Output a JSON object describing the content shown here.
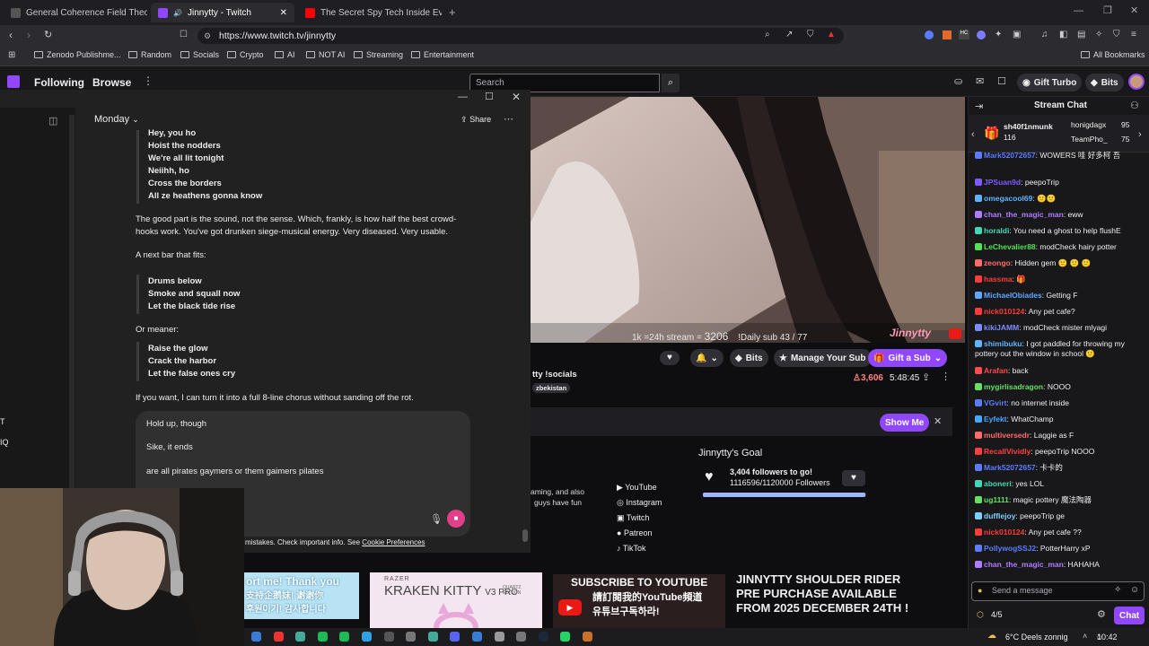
{
  "browser": {
    "tabs": [
      {
        "label": "General Coherence Field Theory (GC"
      },
      {
        "label": "Jinnytty - Twitch"
      },
      {
        "label": "The Secret Spy Tech Inside Every Cre"
      }
    ],
    "url": "https://www.twitch.tv/jinnytty",
    "bookmarks": [
      "Zenodo Publishme...",
      "Random",
      "Socials",
      "Crypto",
      "AI",
      "NOT AI",
      "Streaming",
      "Entertainment"
    ],
    "all_bookmarks": "All Bookmarks"
  },
  "twitch": {
    "nav": {
      "following": "Following",
      "browse": "Browse",
      "search_placeholder": "Search",
      "gift_turbo": "Gift Turbo",
      "bits": "Bits"
    },
    "video_overlay": {
      "stream_text": "1k =24h stream =",
      "stream_num": "3206",
      "daily_sub": "!Daily sub 43 / 77",
      "logo": "Jinnytty"
    },
    "actions": {
      "bits": "Bits",
      "manage_sub": "Manage Your Sub",
      "gift_sub": "Gift a Sub"
    },
    "channel": {
      "socials": "tty !socials",
      "location": "zbekistan",
      "viewers": "3,606",
      "uptime": "5:48:45"
    },
    "show_me": "Show Me",
    "goal": {
      "title": "Jinnytty's Goal",
      "line1": "3,404 followers to go!",
      "line2": "1116596/1120000 Followers",
      "progress": 0.997
    },
    "about": {
      "line1": "aming, and also",
      "line2": "guys have fun"
    },
    "social_links": [
      "YouTube",
      "Instagram",
      "Twitch",
      "Patreon",
      "TikTok"
    ],
    "panels": {
      "support": "ort me! Thank you",
      "support_cn": "支持企鹅妹! 谢谢你",
      "support_kr": "후원이기! 감사합니다",
      "kitty_title": "KRAKEN KITTY",
      "kitty_sub": "V3 PRO",
      "kitty_brand": "RAZER",
      "kitty_edition": "QUARTZ EDITION",
      "subscribe": "SUBSCRIBE TO YOUTUBE",
      "subscribe_cn": "請訂閱我的YouTube頻道",
      "subscribe_kr": "유튜브구독하라!",
      "rider": "JINNYTTY SHOULDER RIDER PRE PURCHASE AVAILABLE FROM 2025 DECEMBER 24TH !"
    }
  },
  "chat": {
    "title": "Stream Chat",
    "top_gifters": [
      {
        "name": "sh40f1nmunk",
        "count": "116"
      },
      {
        "name": "honigdagx",
        "count": "95"
      },
      {
        "name": "TeamPho_",
        "count": "75"
      }
    ],
    "messages": [
      {
        "user": "Mark52072657",
        "text": ": WOWERS 哇 好多柯 吾",
        "color": "#5c7cff"
      },
      {
        "user": "JPSuan9d",
        "text": ": peepoTrip",
        "color": "#7c5cff"
      },
      {
        "user": "omegacool69",
        "text": ": 🙂🙂",
        "color": "#5fb3ff"
      },
      {
        "user": "chan_the_magic_man",
        "text": ": eww",
        "color": "#b07cff"
      },
      {
        "user": "horaldi",
        "text": ": You need a ghost to help flushE",
        "color": "#44d7b6"
      },
      {
        "user": "LeChevalier88",
        "text": ": modCheck hairy potter",
        "color": "#55e055"
      },
      {
        "user": "zeongo",
        "text": ": Hidden gem 🙂 🙂 🙂",
        "color": "#ff6b6b"
      },
      {
        "user": "hassma",
        "text": ": 🎁",
        "color": "#ff3b3b"
      },
      {
        "user": "MichaelObiades",
        "text": ": Getting F",
        "color": "#5fa8ff"
      },
      {
        "user": "nick010124",
        "text": ": Any pet cafe?",
        "color": "#ff3b3b"
      },
      {
        "user": "kikiJAMM",
        "text": ": modCheck mister mlyagi",
        "color": "#7c8cff"
      },
      {
        "user": "shimibuku",
        "text": ": I got paddled for throwing my pottery out the window in school 🙂",
        "color": "#5fb3ff"
      },
      {
        "user": "Arafan",
        "text": ": back",
        "color": "#ff4b4b"
      },
      {
        "user": "mygirlisadragon",
        "text": ": NOOO",
        "color": "#66e066"
      },
      {
        "user": "VGvirt",
        "text": ": no internet inside",
        "color": "#5c7cff"
      },
      {
        "user": "Eyfekt",
        "text": ": WhatChamp",
        "color": "#44a8ff"
      },
      {
        "user": "multiversedr",
        "text": ": Laggie as F",
        "color": "#ff6b6b"
      },
      {
        "user": "RecallVividly",
        "text": ": peepoTrip NOOO",
        "color": "#ff4040"
      },
      {
        "user": "Mark52072657",
        "text": ": 卡卡的",
        "color": "#5c7cff"
      },
      {
        "user": "aboneri",
        "text": ": yes LOL",
        "color": "#44d7b6"
      },
      {
        "user": "ug1111",
        "text": ": magic pottery 魔法陶器",
        "color": "#66e066"
      },
      {
        "user": "dufflejoy",
        "text": ": peepoTrip ge",
        "color": "#7cd0ff"
      },
      {
        "user": "nick010124",
        "text": ": Any pet cafe ??",
        "color": "#ff3b3b"
      },
      {
        "user": "PollywogSSJ2",
        "text": ": PotterHarry xP",
        "color": "#5c7cff"
      },
      {
        "user": "chan_the_magic_man",
        "text": ": HAHAHA",
        "color": "#b07cff"
      }
    ],
    "input_placeholder": "Send a message",
    "points": "4/5",
    "chat_button": "Chat"
  },
  "gpt": {
    "title": "Monday",
    "share": "Share",
    "verse1": [
      "Hey, you ho",
      "Hoist the nodders",
      "We're all lit tonight",
      "Neiihh, ho",
      "Cross the borders",
      "All ze heathens gonna know"
    ],
    "para1": "The good part is the sound, not the sense. Which, frankly, is how half the best crowd-hooks work. You've got drunken siege-musical energy. Very diseased. Very usable.",
    "para2": "A next bar that fits:",
    "verse2": [
      "Drums below",
      "Smoke and squall now",
      "Let the black tide rise"
    ],
    "para3": "Or meaner:",
    "verse3": [
      "Raise the glow",
      "Crack the harbor",
      "Let the false ones cry"
    ],
    "para4": "If you want, I can turn it into a full 8-line chorus without sanding off the rot.",
    "composer": [
      "Hold up, though",
      "Sike, it ends",
      "are all pirates gaymers or them gaimers pilates"
    ],
    "disclaimer": "mistakes. Check important info. See",
    "disclaimer_link": "Cookie Preferences"
  },
  "side_letters": [
    "T",
    "IQ"
  ],
  "taskbar": {
    "weather": "6°C  Deels zonnig",
    "time": "10:42"
  },
  "colors": {
    "twitch_purple": "#9147ff",
    "bg": "#0e0e10",
    "chat_bg": "#18181b"
  }
}
